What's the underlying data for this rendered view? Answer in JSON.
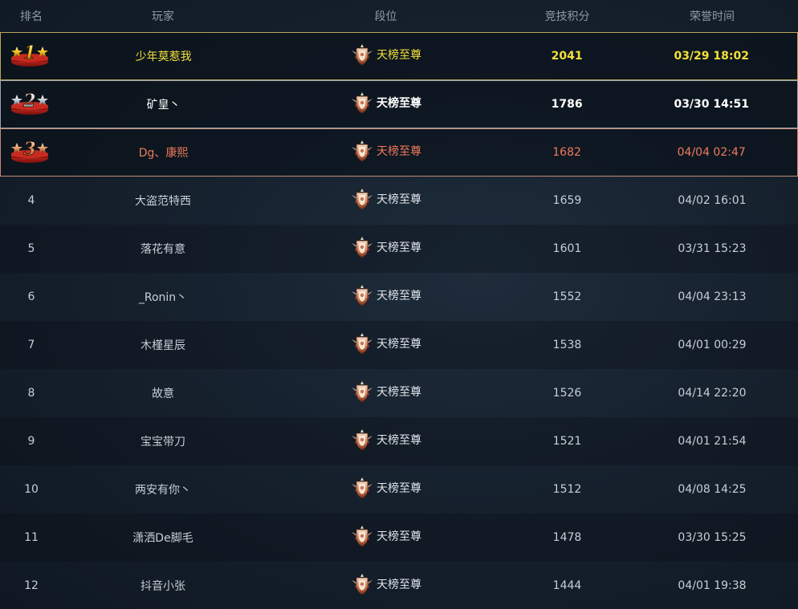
{
  "header": {
    "rank": "排名",
    "player": "玩家",
    "tier": "段位",
    "score": "竞技积分",
    "time": "荣誉时间"
  },
  "rows": [
    {
      "rank": "1",
      "player": "少年莫惹我",
      "tier": "天榜至尊",
      "score": "2041",
      "time": "03/29 18:02"
    },
    {
      "rank": "2",
      "player": "矿皇丶",
      "tier": "天榜至尊",
      "score": "1786",
      "time": "03/30 14:51"
    },
    {
      "rank": "3",
      "player": "Dg、康熙",
      "tier": "天榜至尊",
      "score": "1682",
      "time": "04/04 02:47"
    },
    {
      "rank": "4",
      "player": "大盗范特西",
      "tier": "天榜至尊",
      "score": "1659",
      "time": "04/02 16:01"
    },
    {
      "rank": "5",
      "player": "落花有意",
      "tier": "天榜至尊",
      "score": "1601",
      "time": "03/31 15:23"
    },
    {
      "rank": "6",
      "player": "_Ronin丶",
      "tier": "天榜至尊",
      "score": "1552",
      "time": "04/04 23:13"
    },
    {
      "rank": "7",
      "player": "木槿星辰",
      "tier": "天榜至尊",
      "score": "1538",
      "time": "04/01 00:29"
    },
    {
      "rank": "8",
      "player": "故意",
      "tier": "天榜至尊",
      "score": "1526",
      "time": "04/14 22:20"
    },
    {
      "rank": "9",
      "player": "宝宝带刀",
      "tier": "天榜至尊",
      "score": "1521",
      "time": "04/01 21:54"
    },
    {
      "rank": "10",
      "player": "两安有你丶",
      "tier": "天榜至尊",
      "score": "1512",
      "time": "04/08 14:25"
    },
    {
      "rank": "11",
      "player": "潇洒De脚毛",
      "tier": "天榜至尊",
      "score": "1478",
      "time": "03/30 15:25"
    },
    {
      "rank": "12",
      "player": "抖音小张",
      "tier": "天榜至尊",
      "score": "1444",
      "time": "04/01 19:38"
    }
  ],
  "colors": {
    "first": "#f2e03a",
    "second": "#ffffff",
    "third": "#f07a5c",
    "default": "#c8ced6"
  }
}
